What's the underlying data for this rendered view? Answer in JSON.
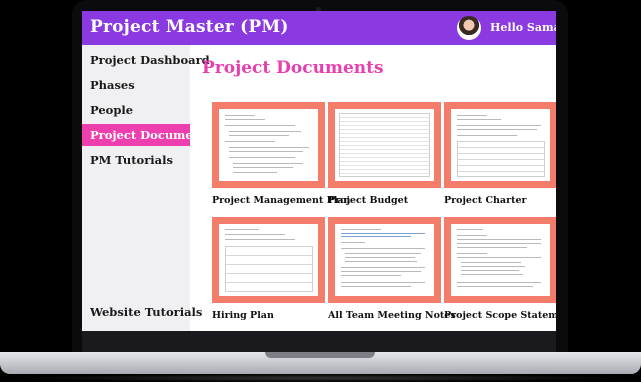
{
  "app": {
    "title": "Project Master (PM)",
    "greeting": "Hello Samantha!"
  },
  "sidebar": {
    "items": [
      {
        "label": "Project Dashboard",
        "active": false
      },
      {
        "label": "Phases",
        "active": false
      },
      {
        "label": "People",
        "active": false
      },
      {
        "label": "Project Documents",
        "active": true
      },
      {
        "label": "PM Tutorials",
        "active": false
      }
    ],
    "footer_item": "Website Tutorials"
  },
  "main": {
    "title": "Project Documents",
    "documents": [
      {
        "label": "Project Management Plan"
      },
      {
        "label": "Project Budget"
      },
      {
        "label": "Project Charter"
      },
      {
        "label": "Hiring Plan"
      },
      {
        "label": "All Team Meeting Notes"
      },
      {
        "label": "Project Scope Statement"
      }
    ]
  },
  "colors": {
    "topbar": "#8a3ae0",
    "accent": "#ee3fae",
    "thumb_border": "#f47c6a"
  }
}
